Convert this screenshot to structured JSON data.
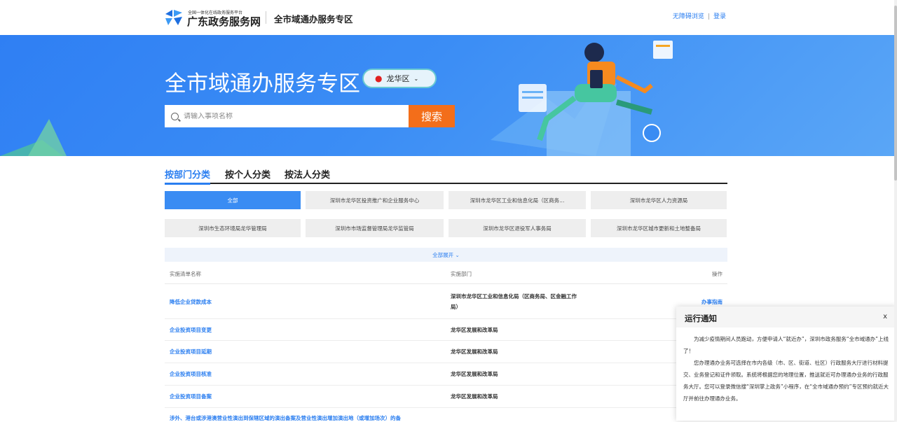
{
  "header": {
    "brand_small": "全国一体化在线政务服务平台",
    "brand_big": "广东政务服务网",
    "zone_title": "全市域通办服务专区",
    "links": [
      "无障碍浏览",
      "登录"
    ],
    "separator": "|"
  },
  "banner": {
    "title": "全市域通办服务专区",
    "region": "龙华区",
    "search_placeholder": "请输入事项名称",
    "search_button": "搜索"
  },
  "tabs": [
    {
      "label": "按部门分类",
      "active": true
    },
    {
      "label": "按个人分类",
      "active": false
    },
    {
      "label": "按法人分类",
      "active": false
    }
  ],
  "departments": [
    "全部",
    "深圳市龙华区投资推广和企业服务中心",
    "深圳市龙华区工业和信息化局（区商务...",
    "深圳市龙华区人力资源局",
    "深圳市生态环境局龙华管理局",
    "深圳市市场监督管理局龙华监管局",
    "深圳市龙华区退役军人事务局",
    "深圳市龙华区城市更新和土地整备局"
  ],
  "expand_label": "全部展开 ⌄",
  "table": {
    "headers": [
      "实施清单名称",
      "实施部门",
      "操作"
    ],
    "rows": [
      {
        "name": "降低企业贷款成本",
        "dept": "深圳市龙华区工业和信息化局（区商务局、区金融工作局）",
        "op": "办事指南"
      },
      {
        "name": "企业投资项目变更",
        "dept": "龙华区发展和改革局",
        "op": ""
      },
      {
        "name": "企业投资项目延期",
        "dept": "龙华区发展和改革局",
        "op": ""
      },
      {
        "name": "企业投资项目核准",
        "dept": "龙华区发展和改革局",
        "op": ""
      },
      {
        "name": "企业投资项目备案",
        "dept": "龙华区发展和改革局",
        "op": ""
      },
      {
        "name": "涉外、港台或涉港澳营业性演出到保辖区域的演出备案及营业性演出增加演出地（或增加场次）的备",
        "dept": "",
        "op": ""
      }
    ]
  },
  "notice": {
    "title": "运行通知",
    "close": "x",
    "paragraphs": [
      "为减少疫情期间人员跑动，方便申请人“就近办”，深圳市政务服务“全市域通办”上线了！",
      "您办理通办业务可选择在市内各级（市、区、街道、社区）行政服务大厅进行材料提交、业务登记和证件领取。系统将根据您的地理位置，推送就近可办理通办业务的行政服务大厅。您可以登录微信搜“深圳掌上政务”小程序，在“全市域通办预约”专区预约就近大厅并前往办理通办业务。"
    ]
  },
  "colors": {
    "primary": "#2a7ef0",
    "banner": "#3b8df5",
    "search_button": "#f36e1a"
  }
}
